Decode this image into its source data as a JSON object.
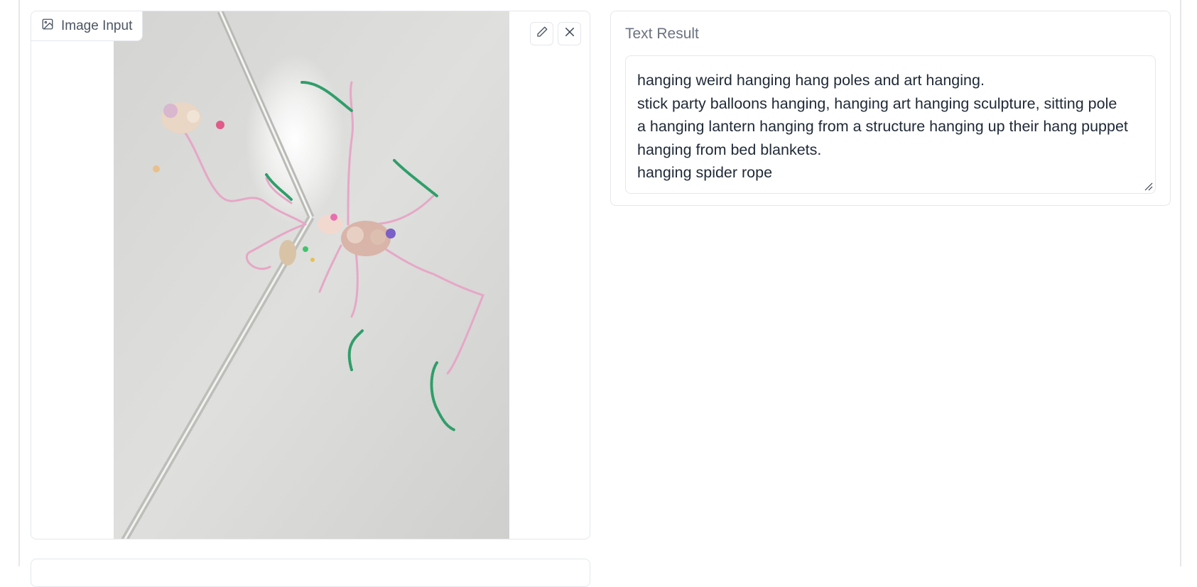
{
  "image_input": {
    "label": "Image Input",
    "label_icon": "image-icon",
    "edit_icon": "pencil-icon",
    "clear_icon": "close-icon"
  },
  "text_result": {
    "label": "Text Result",
    "lines": [
      "hanging weird hanging hang poles and art hanging.",
      "stick party balloons hanging, hanging art hanging sculpture, sitting pole",
      "a hanging lantern hanging from a structure hanging up their hang puppet",
      "hanging from bed blankets.",
      "hanging spider rope"
    ]
  },
  "colors": {
    "border": "#e5e7eb",
    "label_text": "#4b5563",
    "body_text": "#1f2937",
    "wall": "#dcdcdc",
    "yarn_pink": "#e8a6c8",
    "pipe_green": "#2f9e6a"
  }
}
